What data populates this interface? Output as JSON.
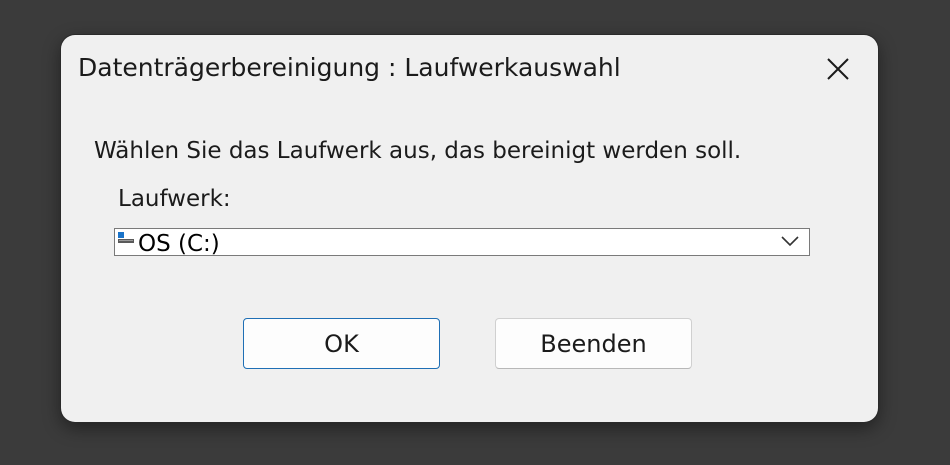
{
  "dialog": {
    "title": "Datenträgerbereinigung : Laufwerkauswahl",
    "close_icon": "close-icon",
    "instruction": "Wählen Sie das Laufwerk aus, das bereinigt werden soll.",
    "drive_label": "Laufwerk:",
    "drive_select": {
      "selected": "OS (C:)",
      "icon": "drive-icon"
    },
    "buttons": {
      "ok": "OK",
      "cancel": "Beenden"
    },
    "colors": {
      "background": "#f0f0f0",
      "accent_border": "#1f6fb5",
      "desktop": "#3b3b3b"
    }
  }
}
